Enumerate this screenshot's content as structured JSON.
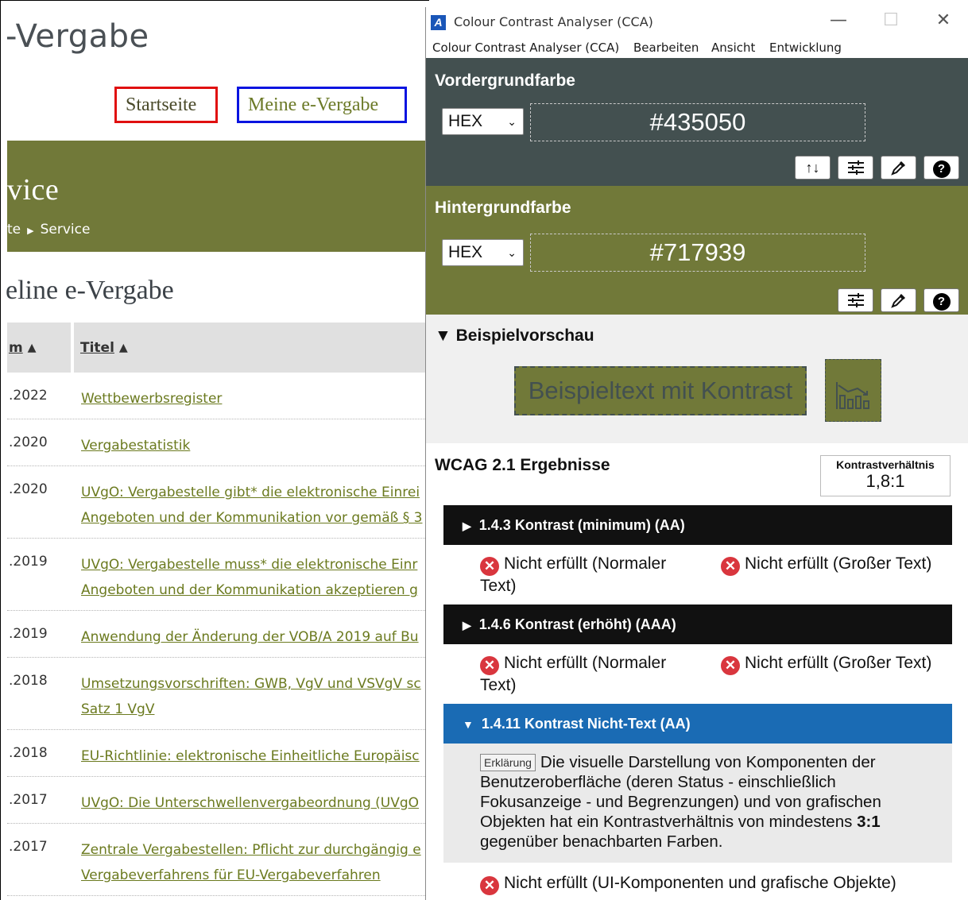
{
  "website": {
    "site_title": "-Vergabe",
    "nav": {
      "startseite": "Startseite",
      "meine": "Meine e-Vergabe"
    },
    "banner_title": "vice",
    "breadcrumb": {
      "prev": "te",
      "current": "Service"
    },
    "section_title": "eline e-Vergabe",
    "table": {
      "col_date": "m",
      "col_title": "Titel",
      "rows": [
        {
          "date": ".2022",
          "title": [
            "Wettbewerbsregister"
          ]
        },
        {
          "date": ".2020",
          "title": [
            "Vergabestatistik"
          ]
        },
        {
          "date": ".2020",
          "title": [
            "UVgO: Vergabestelle gibt* die elektronische Einrei",
            "Angeboten und der Kommunikation vor gemäß § 3"
          ]
        },
        {
          "date": ".2019",
          "title": [
            "UVgO: Vergabestelle muss* die elektronische Einr",
            "Angeboten und der Kommunikation akzeptieren g"
          ]
        },
        {
          "date": ".2019",
          "title": [
            "Anwendung der Änderung der VOB/A 2019 auf Bu"
          ]
        },
        {
          "date": ".2018",
          "title": [
            "Umsetzungsvorschriften: GWB, VgV und VSVgV sc",
            "Satz 1 VgV"
          ]
        },
        {
          "date": ".2018",
          "title": [
            "EU-Richtlinie: elektronische Einheitliche Europäisc"
          ]
        },
        {
          "date": ".2017",
          "title": [
            "UVgO: Die Unterschwellenvergabeordnung (UVgO"
          ]
        },
        {
          "date": ".2017",
          "title": [
            "Zentrale Vergabestellen: Pflicht zur durchgängig e",
            "Vergabeverfahrens für EU-Vergabeverfahren"
          ]
        }
      ]
    }
  },
  "cca": {
    "window_title": "Colour Contrast Analyser (CCA)",
    "menu": [
      "Colour Contrast Analyser (CCA)",
      "Bearbeiten",
      "Ansicht",
      "Entwicklung"
    ],
    "foreground": {
      "label": "Vordergrundfarbe",
      "format": "HEX",
      "value": "#435050",
      "color": "#435050"
    },
    "background": {
      "label": "Hintergrundfarbe",
      "format": "HEX",
      "value": "#717939",
      "color": "#717939"
    },
    "preview": {
      "heading": "Beispielvorschau",
      "sample_text": "Beispieltext mit Kontrast"
    },
    "results": {
      "heading": "WCAG 2.1 Ergebnisse",
      "ratio_label": "Kontrastverhältnis",
      "ratio_value": "1,8:1",
      "criteria": [
        {
          "title": "1.4.3 Kontrast (minimum) (AA)",
          "normal": "Nicht erfüllt (Normaler Text)",
          "large": "Nicht erfüllt (Großer Text)"
        },
        {
          "title": "1.4.6 Kontrast (erhöht) (AAA)",
          "normal": "Nicht erfüllt (Normaler Text)",
          "large": "Nicht erfüllt (Großer Text)"
        },
        {
          "title": "1.4.11 Kontrast Nicht-Text (AA)",
          "explain_button": "Erklärung",
          "explain_text": "Die visuelle Darstellung von Komponenten der Benutzeroberfläche (deren Status - einschließlich Fokusanzeige - und Begrenzungen) und von grafischen Objekten hat ein Kontrastverhältnis von mindestens",
          "explain_bold": "3:1",
          "explain_tail": "gegenüber benachbarten Farben.",
          "result": "Nicht erfüllt (UI-Komponenten und grafische Objekte)"
        }
      ]
    },
    "colors": {
      "accent_blue": "#1a6bb4",
      "fail_red": "#d9363e"
    }
  }
}
